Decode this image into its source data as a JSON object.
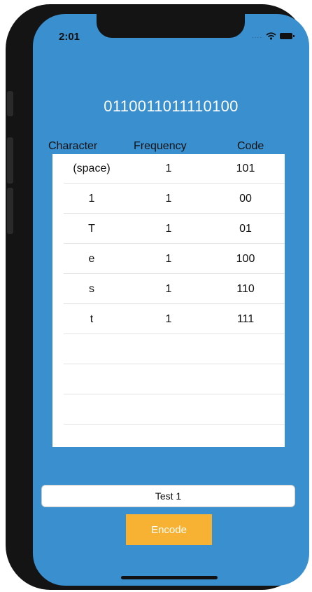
{
  "status": {
    "time": "2:01"
  },
  "encoded_output": "0110011011110100",
  "table": {
    "headers": [
      "Character",
      "Frequency",
      "Code"
    ],
    "rows": [
      {
        "character": "(space)",
        "frequency": "1",
        "code": "101"
      },
      {
        "character": "1",
        "frequency": "1",
        "code": "00"
      },
      {
        "character": "T",
        "frequency": "1",
        "code": "01"
      },
      {
        "character": "e",
        "frequency": "1",
        "code": "100"
      },
      {
        "character": "s",
        "frequency": "1",
        "code": "110"
      },
      {
        "character": "t",
        "frequency": "1",
        "code": "111"
      }
    ]
  },
  "input": {
    "value": "Test 1"
  },
  "encode_button": {
    "label": "Encode"
  },
  "colors": {
    "background": "#3a8fcf",
    "button": "#f8b233",
    "table": "#ffffff"
  }
}
